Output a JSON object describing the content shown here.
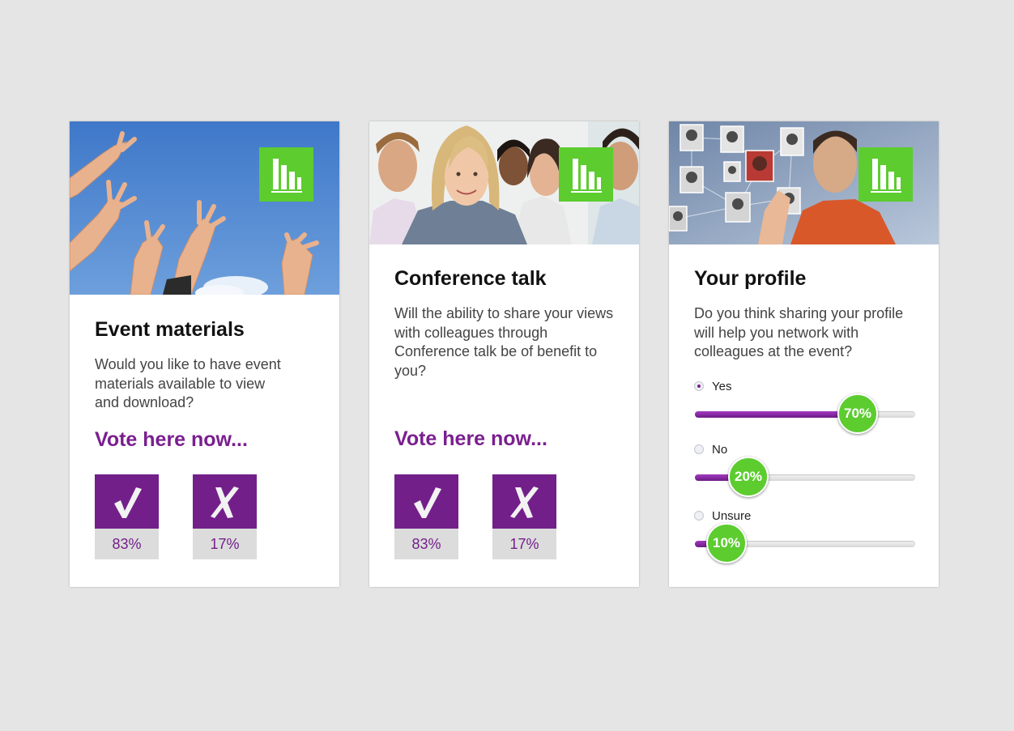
{
  "colors": {
    "background": "#e5e5e5",
    "accent_purple": "#7a1f8f",
    "accent_green": "#5ccc2f",
    "percent_box": "#dcdcdc"
  },
  "icons": {
    "poll": "bar-chart-icon",
    "yes": "checkmark-icon",
    "no": "cross-icon"
  },
  "cards": [
    {
      "title": "Event materials",
      "question": "Would you like to have event materials available to view and download?",
      "cta": "Vote here now...",
      "yes_percent": "83%",
      "no_percent": "17%"
    },
    {
      "title": "Conference talk",
      "question": "Will the ability to share your views with colleagues through Conference talk be of benefit to you?",
      "cta": "Vote here now...",
      "yes_percent": "83%",
      "no_percent": "17%"
    },
    {
      "title": "Your profile",
      "question": "Do you think sharing your profile will help you network with colleagues at the event?",
      "options": [
        {
          "label": "Yes",
          "value": 70,
          "display": "70%",
          "selected": true
        },
        {
          "label": "No",
          "value": 20,
          "display": "20%",
          "selected": false
        },
        {
          "label": "Unsure",
          "value": 10,
          "display": "10%",
          "selected": false
        }
      ]
    }
  ]
}
